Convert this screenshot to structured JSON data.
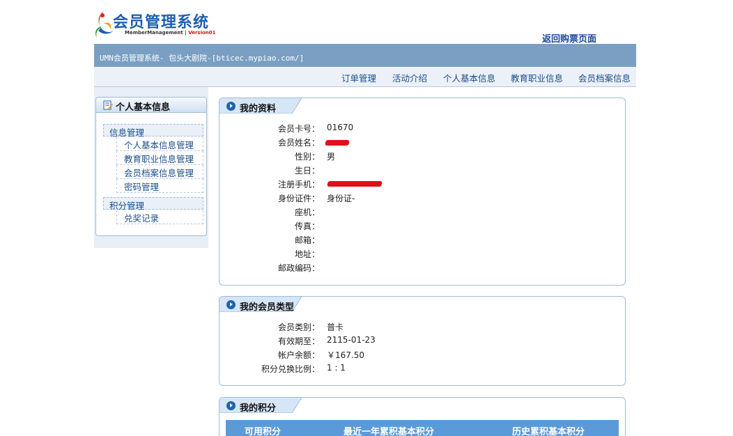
{
  "logo": {
    "title": "会员管理系统",
    "subtitle": "MemberManagement",
    "version": "Version01"
  },
  "header": {
    "return_link": "返回购票页面",
    "banner_text": "UMN会员管理系统- 包头大剧院-[bticec.mypiao.com/]"
  },
  "nav": {
    "items": [
      "订单管理",
      "活动介绍",
      "个人基本信息",
      "教育职业信息",
      "会员档案信息"
    ]
  },
  "sidebar": {
    "title": "个人基本信息",
    "groups": [
      {
        "label": "信息管理",
        "items": [
          "个人基本信息管理",
          "教育职业信息管理",
          "会员档案信息管理",
          "密码管理"
        ]
      },
      {
        "label": "积分管理",
        "items": [
          "兑奖记录"
        ]
      }
    ]
  },
  "profile": {
    "title": "我的资料",
    "fields": [
      {
        "label": "会员卡号：",
        "value": "01670"
      },
      {
        "label": "会员姓名：",
        "value": ""
      },
      {
        "label": "性别：",
        "value": "男"
      },
      {
        "label": "生日：",
        "value": ""
      },
      {
        "label": "注册手机：",
        "value": ""
      },
      {
        "label": "身份证件：",
        "value": "身份证-"
      },
      {
        "label": "座机：",
        "value": ""
      },
      {
        "label": "传真：",
        "value": ""
      },
      {
        "label": "邮箱：",
        "value": ""
      },
      {
        "label": "地址：",
        "value": ""
      },
      {
        "label": "邮政编码：",
        "value": ""
      }
    ]
  },
  "member_type": {
    "title": "我的会员类型",
    "fields": [
      {
        "label": "会员类别：",
        "value": "普卡"
      },
      {
        "label": "有效期至：",
        "value": "2115-01-23"
      },
      {
        "label": "帐户余额：",
        "value": "￥167.50"
      },
      {
        "label": "积分兑换比例：",
        "value": "1 : 1"
      }
    ]
  },
  "points": {
    "title": "我的积分",
    "columns": [
      "可用积分",
      "最近一年累积基本积分",
      "历史累积基本积分"
    ]
  },
  "colors": {
    "banner": "#7a9fc3",
    "link": "#1b4d8c",
    "accent": "#1e63ad",
    "table_header": "#5a9ad8",
    "redaction": "#e0101a"
  }
}
